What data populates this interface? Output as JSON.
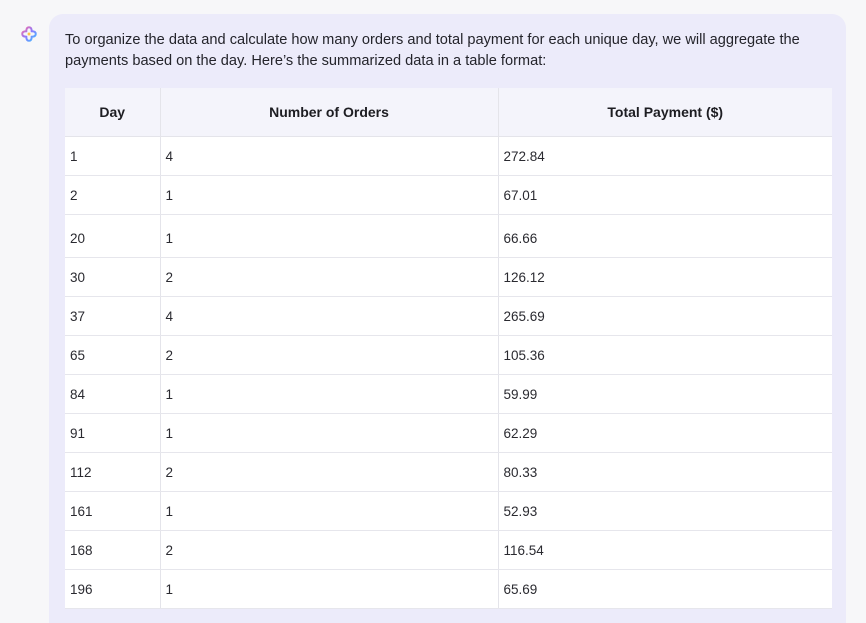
{
  "message": {
    "intro": "To organize the data and calculate how many orders and total payment for each unique day, we will aggregate the payments based on the day. Here’s the summarized data in a table format:"
  },
  "table": {
    "headers": [
      "Day",
      "Number of Orders",
      "Total Payment ($)"
    ],
    "rows": [
      [
        "1",
        "4",
        "272.84"
      ],
      [
        "2",
        "1",
        "67.01"
      ],
      [
        "20",
        "1",
        "66.66"
      ],
      [
        "30",
        "2",
        "126.12"
      ],
      [
        "37",
        "4",
        "265.69"
      ],
      [
        "65",
        "2",
        "105.36"
      ],
      [
        "84",
        "1",
        "59.99"
      ],
      [
        "91",
        "1",
        "62.29"
      ],
      [
        "112",
        "2",
        "80.33"
      ],
      [
        "161",
        "1",
        "52.93"
      ],
      [
        "168",
        "2",
        "116.54"
      ],
      [
        "196",
        "1",
        "65.69"
      ]
    ]
  },
  "icons": {
    "assistant": "assistant-logo-icon"
  },
  "colors": {
    "bubble": "#ecebfa",
    "header_bg": "#f4f4fb"
  }
}
